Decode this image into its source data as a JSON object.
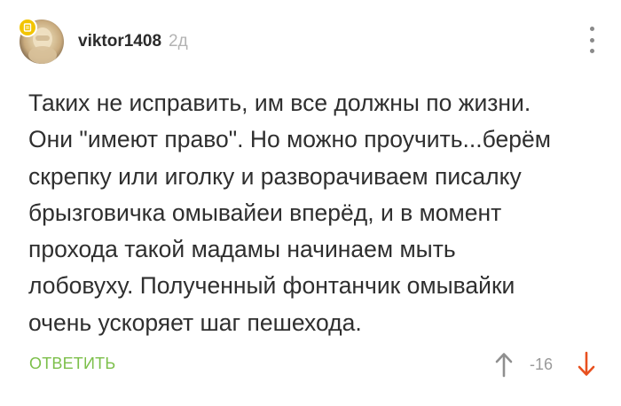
{
  "comment": {
    "author": "viktor1408",
    "time_ago": "2д",
    "avatar_icon": "user-avatar",
    "badge_icon": "document-icon",
    "badge_color": "#f2c400",
    "lines": [
      "Таких не исправить, им все должны по жизни.",
      "Они \"имеют право\". Но можно проучить...берём",
      "скрепку или иголку и разворачиваем писалку",
      "брызговичка омывайеи вперёд, и в момент",
      "прохода такой мадамы начинаем мыть",
      "лобовуху. Полученный фонтанчик омывайки",
      "очень ускоряет шаг пешехода."
    ]
  },
  "actions": {
    "reply_label": "ОТВЕТИТЬ",
    "reply_color": "#7cbf4a",
    "rating": "-16",
    "upvote_icon": "arrow-up-icon",
    "downvote_icon": "arrow-down-icon",
    "downvote_color": "#e8501f",
    "more_icon": "more-vertical-icon"
  }
}
